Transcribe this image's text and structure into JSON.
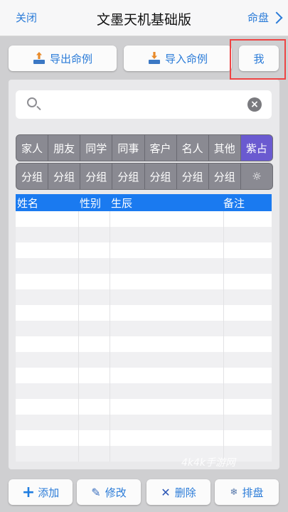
{
  "topbar": {
    "close": "关闭",
    "title": "文墨天机基础版",
    "right": "命盘"
  },
  "actions": {
    "export": "导出命例",
    "import": "导入命例",
    "me": "我"
  },
  "search": {
    "value": "",
    "placeholder": ""
  },
  "categories": [
    "家人",
    "朋友",
    "同学",
    "同事",
    "客户",
    "名人",
    "其他",
    "紫占"
  ],
  "selected_category": "紫占",
  "groups": [
    "分组",
    "分组",
    "分组",
    "分组",
    "分组",
    "分组",
    "分组",
    "☼"
  ],
  "table": {
    "headers": {
      "name": "姓名",
      "gender": "性别",
      "birth": "生辰",
      "note": "备注"
    },
    "rows": []
  },
  "watermark": "4k4k手游网",
  "bottom": {
    "add": "添加",
    "edit": "修改",
    "delete": "删除",
    "chart": "排盘"
  },
  "colors": {
    "accent": "#2a7bd8",
    "header": "#1a7af0",
    "selected": "#6a5ad0",
    "highlight": "#e44444"
  }
}
